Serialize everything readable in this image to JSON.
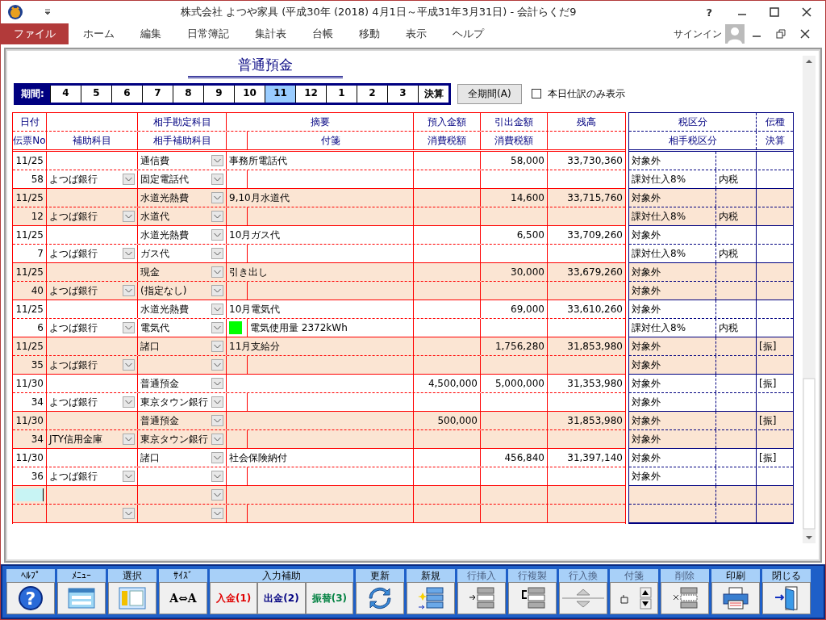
{
  "window": {
    "title": "株式会社  よつや家具 (平成30年 (2018) 4月1日～平成31年3月31日) - 会計らくだ9"
  },
  "menu": [
    {
      "label": "ファイル",
      "selected": true
    },
    {
      "label": "ホーム",
      "selected": false
    },
    {
      "label": "編集",
      "selected": false
    },
    {
      "label": "日常簿記",
      "selected": false
    },
    {
      "label": "集計表",
      "selected": false
    },
    {
      "label": "台帳",
      "selected": false
    },
    {
      "label": "移動",
      "selected": false
    },
    {
      "label": "表示",
      "selected": false
    },
    {
      "label": "ヘルプ",
      "selected": false
    }
  ],
  "help_glyph": "?",
  "sign_in": "サインイン",
  "ledger_title": "普通預金",
  "period": {
    "label": "期間:",
    "items": [
      {
        "label": "4",
        "selected": false
      },
      {
        "label": "5",
        "selected": false
      },
      {
        "label": "6",
        "selected": false
      },
      {
        "label": "7",
        "selected": false
      },
      {
        "label": "8",
        "selected": false
      },
      {
        "label": "9",
        "selected": false
      },
      {
        "label": "10",
        "selected": false
      },
      {
        "label": "11",
        "selected": true
      },
      {
        "label": "12",
        "selected": false
      },
      {
        "label": "1",
        "selected": false
      },
      {
        "label": "2",
        "selected": false
      },
      {
        "label": "3",
        "selected": false
      },
      {
        "label": "決算",
        "selected": false
      }
    ],
    "all_button": "全期間(A)",
    "today_only": {
      "label": "本日仕訳のみ表示",
      "checked": false
    }
  },
  "columns": {
    "date": "日付",
    "voucher": "伝票No",
    "sub_account": "補助科目",
    "counter_account": "相手勘定科目",
    "counter_sub": "相手補助科目",
    "memo": "摘要",
    "tag": "付箋",
    "deposit": "預入金額",
    "deposit_tax": "消費税額",
    "withdrawal": "引出金額",
    "withdrawal_tax": "消費税額",
    "balance": "残高",
    "tax": "税区分",
    "counter_tax": "相手税区分",
    "slip_type": "伝種",
    "settlement": "決算"
  },
  "entries": [
    {
      "date": "11/25",
      "voucher": "58",
      "sub_account": "よつば銀行",
      "counter_account": "通信費",
      "counter_sub": "固定電話代",
      "memo": "事務所電話代",
      "withdrawal": "58,000",
      "balance": "33,730,360",
      "tax": "対象外",
      "counter_tax": "課対仕入8%",
      "counter_tax_type": "内税"
    },
    {
      "date": "11/25",
      "voucher": "12",
      "sub_account": "よつば銀行",
      "counter_account": "水道光熱費",
      "counter_sub": "水道代",
      "memo": "9,10月水道代",
      "withdrawal": "14,600",
      "balance": "33,715,760",
      "tax": "対象外",
      "counter_tax": "課対仕入8%",
      "counter_tax_type": "内税"
    },
    {
      "date": "11/25",
      "voucher": "7",
      "sub_account": "よつば銀行",
      "counter_account": "水道光熱費",
      "counter_sub": "ガス代",
      "memo": "10月ガス代",
      "withdrawal": "6,500",
      "balance": "33,709,260",
      "tax": "対象外",
      "counter_tax": "課対仕入8%",
      "counter_tax_type": "内税"
    },
    {
      "date": "11/25",
      "voucher": "40",
      "sub_account": "よつば銀行",
      "counter_account": "現金",
      "counter_sub": "(指定なし)",
      "memo": "引き出し",
      "withdrawal": "30,000",
      "balance": "33,679,260",
      "tax": "対象外",
      "counter_tax": "対象外"
    },
    {
      "date": "11/25",
      "voucher": "6",
      "sub_account": "よつば銀行",
      "counter_account": "水道光熱費",
      "counter_sub": "電気代",
      "memo": "10月電気代",
      "color": "#00ff00",
      "tag": "電気使用量  2372kWh",
      "withdrawal": "69,000",
      "balance": "33,610,260",
      "tax": "対象外",
      "counter_tax": "課対仕入8%",
      "counter_tax_type": "内税"
    },
    {
      "date": "11/25",
      "voucher": "35",
      "sub_account": "よつば銀行",
      "counter_account": "諸口",
      "memo": "11月支給分",
      "withdrawal": "1,756,280",
      "balance": "31,853,980",
      "tax": "対象外",
      "counter_tax": "対象外",
      "slip_type": "[振]"
    },
    {
      "date": "11/30",
      "voucher": "34",
      "sub_account": "よつば銀行",
      "counter_account": "普通預金",
      "counter_sub": "東京タウン銀行",
      "deposit": "4,500,000",
      "withdrawal": "5,000,000",
      "balance": "31,353,980",
      "tax": "対象外",
      "counter_tax": "対象外",
      "slip_type": "[振]"
    },
    {
      "date": "11/30",
      "voucher": "34",
      "sub_account": "JTY信用金庫",
      "counter_account": "普通預金",
      "counter_sub": "東京タウン銀行",
      "deposit": "500,000",
      "balance": "31,853,980",
      "tax": "対象外",
      "counter_tax": "対象外",
      "slip_type": "[振]"
    },
    {
      "date": "11/30",
      "voucher": "36",
      "sub_account": "よつば銀行",
      "counter_account": "諸口",
      "memo": "社会保険納付",
      "withdrawal": "456,840",
      "balance": "31,397,140",
      "tax": "対象外",
      "counter_tax": "対象外",
      "slip_type": "[振]"
    }
  ],
  "new_entry": {
    "focused": true
  },
  "toolbar": [
    {
      "label": "ﾍﾙﾌﾟ",
      "kind": "help",
      "glyph": "?",
      "disabled": false
    },
    {
      "label": "ﾒﾆｭｰ",
      "kind": "menu",
      "disabled": false
    },
    {
      "label": "選択",
      "kind": "select",
      "disabled": false
    },
    {
      "label": "ｻｲｽﾞ",
      "kind": "size",
      "glyph": "A⇔A",
      "disabled": false
    },
    {
      "label": "入力補助",
      "kind": "assist",
      "buttons": [
        {
          "label": "入金(1)",
          "color": "#e00000"
        },
        {
          "label": "出金(2)",
          "color": "#000080"
        },
        {
          "label": "振替(3)",
          "color": "#008040"
        }
      ],
      "disabled": false
    },
    {
      "label": "更新",
      "kind": "refresh",
      "disabled": false
    },
    {
      "label": "新規",
      "kind": "new",
      "disabled": false
    },
    {
      "label": "行挿入",
      "kind": "insert",
      "disabled": true
    },
    {
      "label": "行複製",
      "kind": "duplicate",
      "disabled": true
    },
    {
      "label": "行入換",
      "kind": "swap",
      "disabled": true
    },
    {
      "label": "付箋",
      "kind": "tag",
      "disabled": true
    },
    {
      "label": "削除",
      "kind": "delete",
      "disabled": true
    },
    {
      "label": "印刷",
      "kind": "print",
      "disabled": false
    },
    {
      "label": "閉じる",
      "kind": "close",
      "disabled": false
    }
  ]
}
